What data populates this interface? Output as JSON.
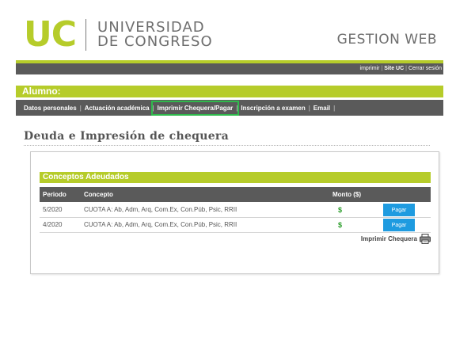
{
  "brand": {
    "logo_short": "UC",
    "logo_line1": "UNIVERSIDAD",
    "logo_line2": "DE CONGRESO",
    "system_title": "GESTION WEB"
  },
  "top_links": [
    "imprimir",
    "Site UC",
    "Cerrar sesión"
  ],
  "student_label": "Alumno:",
  "nav": {
    "items": [
      {
        "label": "Datos personales"
      },
      {
        "label": "Actuación académica"
      },
      {
        "label": "Imprimir Chequera/Pagar"
      },
      {
        "label": "Inscripción a examen"
      },
      {
        "label": "Email"
      }
    ],
    "separator": "|",
    "active_index": 2
  },
  "page_title": "Deuda e Impresión de chequera",
  "section_title": "Conceptos Adeudados",
  "table": {
    "headers": [
      "Periodo",
      "Concepto",
      "Monto ($)"
    ],
    "rows": [
      {
        "periodo": "5/2020",
        "concepto": "CUOTA A: Ab, Adm, Arq, Com.Ex, Con.Púb, Psic, RRII",
        "monto": "$",
        "action": "Pagar"
      },
      {
        "periodo": "4/2020",
        "concepto": "CUOTA A: Ab, Adm, Arq, Com.Ex, Con.Púb, Psic, RRII",
        "monto": "$",
        "action": "Pagar"
      }
    ]
  },
  "print_label": "Imprimir Chequera",
  "colors": {
    "brand_green": "#b6cc2a",
    "bar_gray": "#5a5a5a",
    "pay_blue": "#1e9be0",
    "highlight_green": "#2fb84c"
  },
  "icons": {
    "print": "printer-icon"
  }
}
